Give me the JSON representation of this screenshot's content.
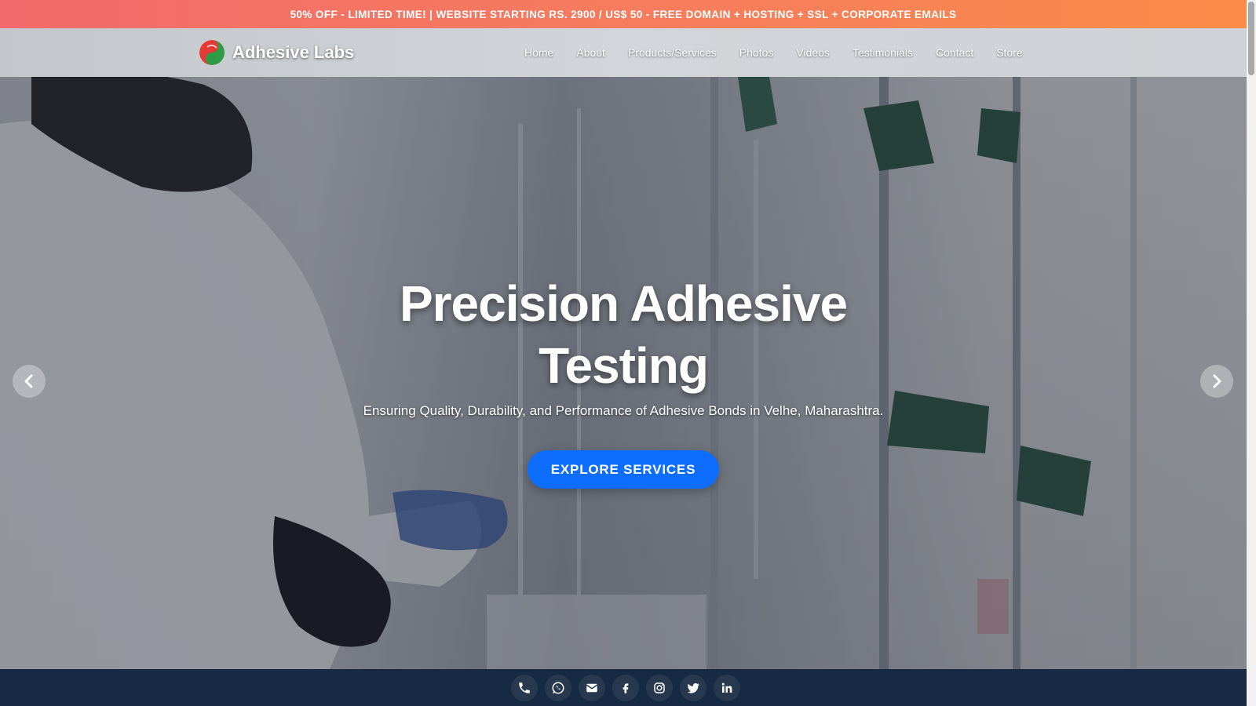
{
  "promo": {
    "text": "50% OFF - LIMITED TIME! | WEBSITE STARTING RS. 2900 / US$ 50 - FREE DOMAIN + HOSTING + SSL + CORPORATE EMAILS",
    "gradient_start": "#f26a6a",
    "gradient_end": "#fb8b48"
  },
  "brand": {
    "name": "Adhesive Labs",
    "logo_colors": [
      "#e53935",
      "#2e9b47"
    ]
  },
  "nav": {
    "items": [
      {
        "label": "Home"
      },
      {
        "label": "About"
      },
      {
        "label": "Products/Services"
      },
      {
        "label": "Photos"
      },
      {
        "label": "Videos"
      },
      {
        "label": "Testimonials"
      },
      {
        "label": "Contact"
      },
      {
        "label": "Store"
      }
    ]
  },
  "hero": {
    "title_line1": "Precision Adhesive",
    "title_line2": "Testing",
    "subtitle": "Ensuring Quality, Durability, and Performance of Adhesive Bonds in Velhe, Maharashtra.",
    "cta_label": "EXPLORE SERVICES",
    "cta_color": "#0d6efd",
    "prev_icon": "chevron-left-icon",
    "next_icon": "chevron-right-icon"
  },
  "footer": {
    "background": "#172a44",
    "social": [
      {
        "icon": "phone-icon"
      },
      {
        "icon": "whatsapp-icon"
      },
      {
        "icon": "email-icon"
      },
      {
        "icon": "facebook-icon"
      },
      {
        "icon": "instagram-icon"
      },
      {
        "icon": "twitter-icon"
      },
      {
        "icon": "linkedin-icon"
      }
    ]
  }
}
